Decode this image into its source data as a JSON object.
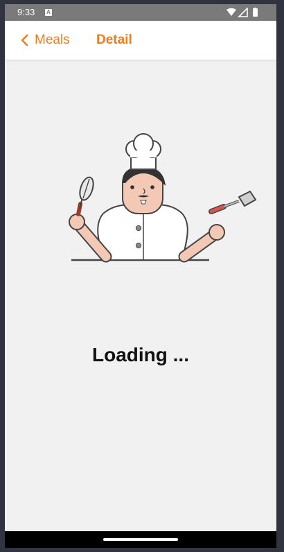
{
  "status_bar": {
    "time": "9:33",
    "notification_icon": "A",
    "icons": [
      "wifi-icon",
      "signal-icon",
      "battery-icon"
    ]
  },
  "app_bar": {
    "back_label": "Meals",
    "title": "Detail",
    "accent_color": "#f07d1a"
  },
  "content": {
    "illustration": "chef-illustration",
    "loading_text": "Loading ..."
  }
}
